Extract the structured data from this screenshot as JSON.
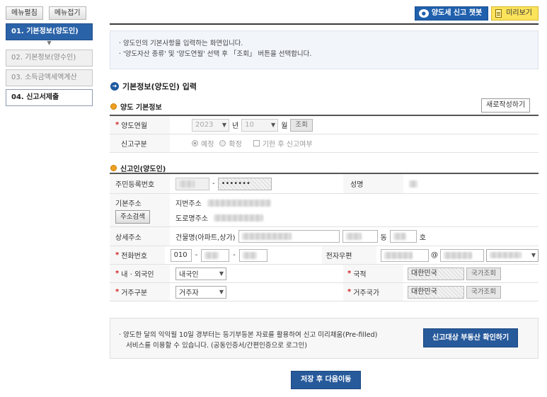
{
  "sidebar": {
    "expand_label": "메뉴펼침",
    "collapse_label": "메뉴접기",
    "steps": [
      {
        "label": "01. 기본정보(양도인)"
      },
      {
        "label": "02. 기본정보(양수인)"
      },
      {
        "label": "03. 소득금액세액계산"
      },
      {
        "label": "04. 신고서제출"
      }
    ]
  },
  "header": {
    "chat_label": "양도세 신고 챗봇",
    "preview_label": "미리보기"
  },
  "info": {
    "lines": [
      "양도인의 기본사항을 입력하는 화면입니다.",
      "'양도자산 종류' 및 '양도연월' 선택 후 「조회」 버튼을 선택합니다."
    ]
  },
  "section": {
    "title": "기본정보(양도인) 입력",
    "sub1": "양도 기본정보",
    "new_button": "새로작성하기",
    "sub2": "신고인(양도인)"
  },
  "transfer": {
    "date_label": "양도연월",
    "year": "2023",
    "year_unit": "년",
    "month": "10",
    "month_unit": "월",
    "inquiry_button": "조회",
    "type_label": "신고구분",
    "radio_scheduled": "예정",
    "radio_final": "확정",
    "late_check": "기한 후 신고여부"
  },
  "filer": {
    "rrn_label": "주민등록번호",
    "rrn_dash": "-",
    "rrn_back": "•••••••",
    "name_label": "성명",
    "addr_label": "기본주소",
    "addr_search": "주소검색",
    "lot_addr": "지번주소",
    "road_addr": "도로명주소",
    "detail_label": "상세주소",
    "building_label": "건물명(아파트,상가)",
    "dong_unit": "동",
    "ho_unit": "호",
    "phone_label": "전화번호",
    "phone_1": "010",
    "phone_dash": "-",
    "email_label": "전자우편",
    "email_at": "@",
    "nationality_type_label": "내 · 외국인",
    "nationality_type": "내국인",
    "country_label": "국적",
    "country_value": "대한민국",
    "country_button": "국가조회",
    "residence_label": "거주구분",
    "residence_value": "거주자",
    "res_country_label": "거주국가",
    "res_country_value": "대한민국",
    "res_country_button": "국가조회"
  },
  "notice": {
    "line1": "양도한 달의 익익월 10일 경부터는 등기부등본 자료를 활용하여 신고 미리채움(Pre-filled)",
    "line2": "서비스를 이용할 수 있습니다. (공동인증서/간편인증으로 로그인)",
    "button": "신고대상 부동산 확인하기"
  },
  "footer": {
    "save_button": "저장 후 다음이동"
  }
}
